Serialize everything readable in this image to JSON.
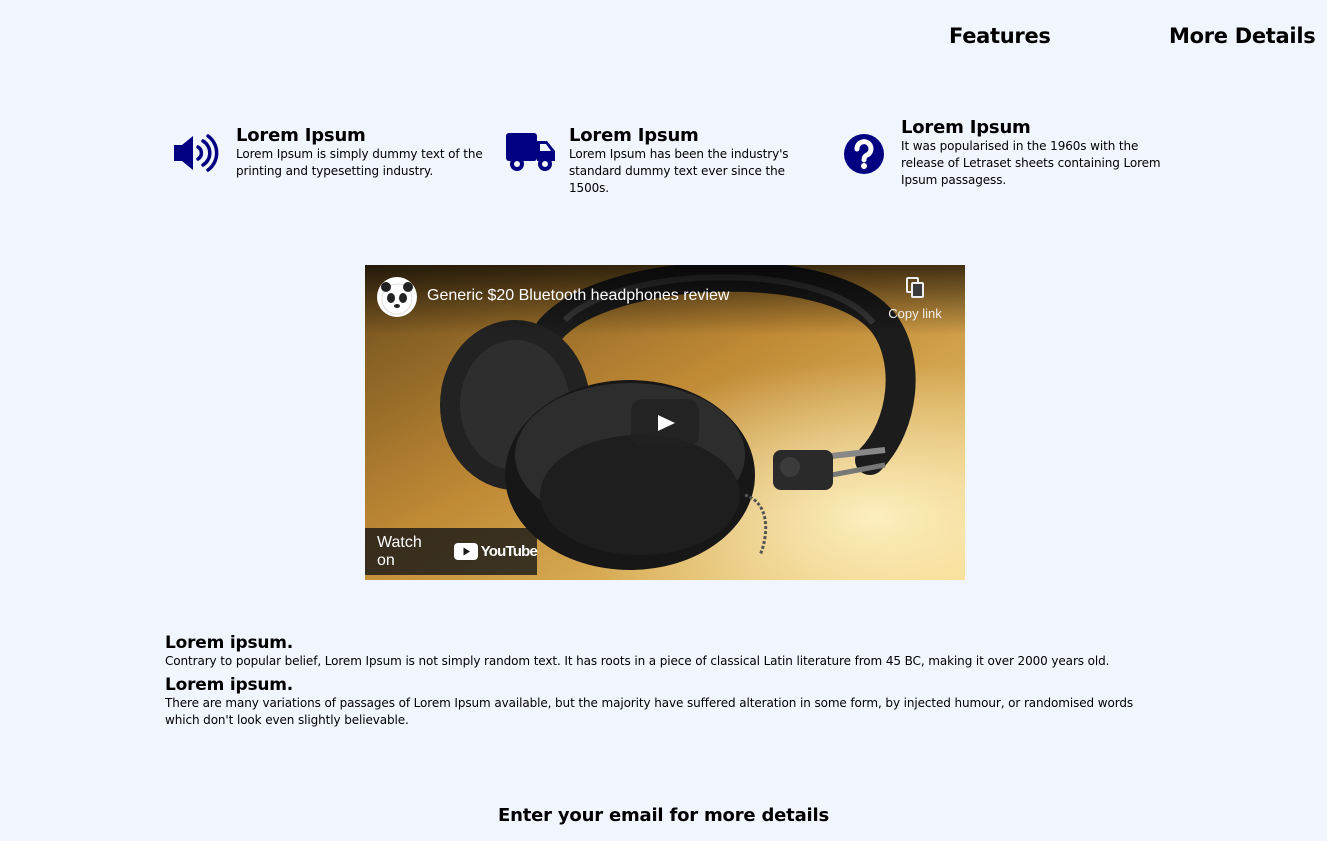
{
  "nav": {
    "features": "Features",
    "more_details": "More Details"
  },
  "features": [
    {
      "icon": "volume-icon",
      "title": "Lorem Ipsum",
      "text": "Lorem Ipsum is simply dummy text of the printing and typesetting industry."
    },
    {
      "icon": "truck-icon",
      "title": "Lorem Ipsum",
      "text": "Lorem Ipsum has been the industry's standard dummy text ever since the 1500s."
    },
    {
      "icon": "question-circle-icon",
      "title": "Lorem Ipsum",
      "text": "It was popularised in the 1960s with the release of Letraset sheets containing Lorem Ipsum passagess."
    }
  ],
  "colors": {
    "icon": "#000080",
    "background": "#f1f5fd"
  },
  "video": {
    "title": "Generic $20 Bluetooth headphones review",
    "copy_link": "Copy link",
    "watch_on": "Watch on",
    "youtube": "YouTube"
  },
  "info": [
    {
      "title": "Lorem ipsum.",
      "text": "Contrary to popular belief, Lorem Ipsum is not simply random text. It has roots in a piece of classical Latin literature from 45 BC, making it over 2000 years old."
    },
    {
      "title": "Lorem ipsum.",
      "text": "There are many variations of passages of Lorem Ipsum available, but the majority have suffered alteration in some form, by injected humour, or randomised words which don't look even slightly believable."
    }
  ],
  "cta": {
    "text": "Enter your email for more details"
  }
}
